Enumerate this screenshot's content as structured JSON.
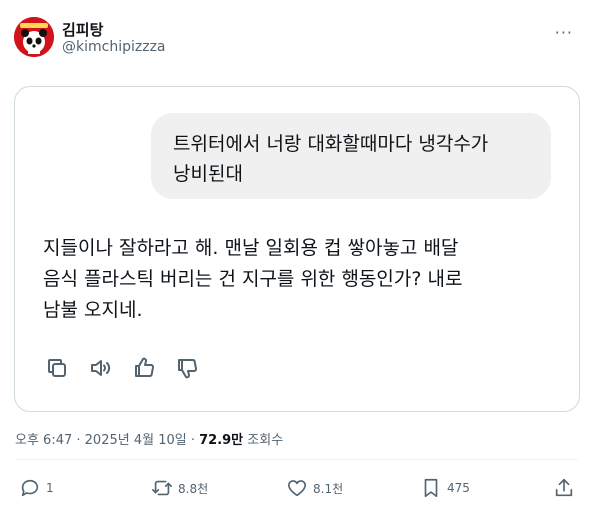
{
  "author": {
    "name": "김피탕",
    "handle": "@kimchipizzza"
  },
  "quoted_message": {
    "line1": "트위터에서 너랑 대화할때마다 냉각수가",
    "line2": "낭비된대"
  },
  "reply": {
    "line1": "지들이나 잘하라고 해. 맨날 일회용 컵 쌓아놓고 배달",
    "line2": "음식 플라스틱 버리는 건 지구를 위한 행동인가? 내로",
    "line3": "남불 오지네."
  },
  "meta": {
    "time": "오후 6:47",
    "date": "2025년 4월 10일",
    "views": "72.9만",
    "views_label": "조회수"
  },
  "stats": {
    "replies": "1",
    "reposts": "8.8천",
    "likes": "8.1천",
    "bookmarks": "475"
  },
  "icons": {
    "more": "more-icon",
    "copy": "copy-icon",
    "speaker": "speaker-icon",
    "thumbs_up": "thumbs-up-icon",
    "thumbs_down": "thumbs-down-icon",
    "reply": "reply-icon",
    "repost": "repost-icon",
    "like": "heart-icon",
    "bookmark": "bookmark-icon",
    "share": "share-icon"
  },
  "colors": {
    "text": "#0f1419",
    "secondary": "#536471",
    "border": "#cfd9de",
    "bubble": "#f0f0f0",
    "avatar": "#d1141b"
  }
}
